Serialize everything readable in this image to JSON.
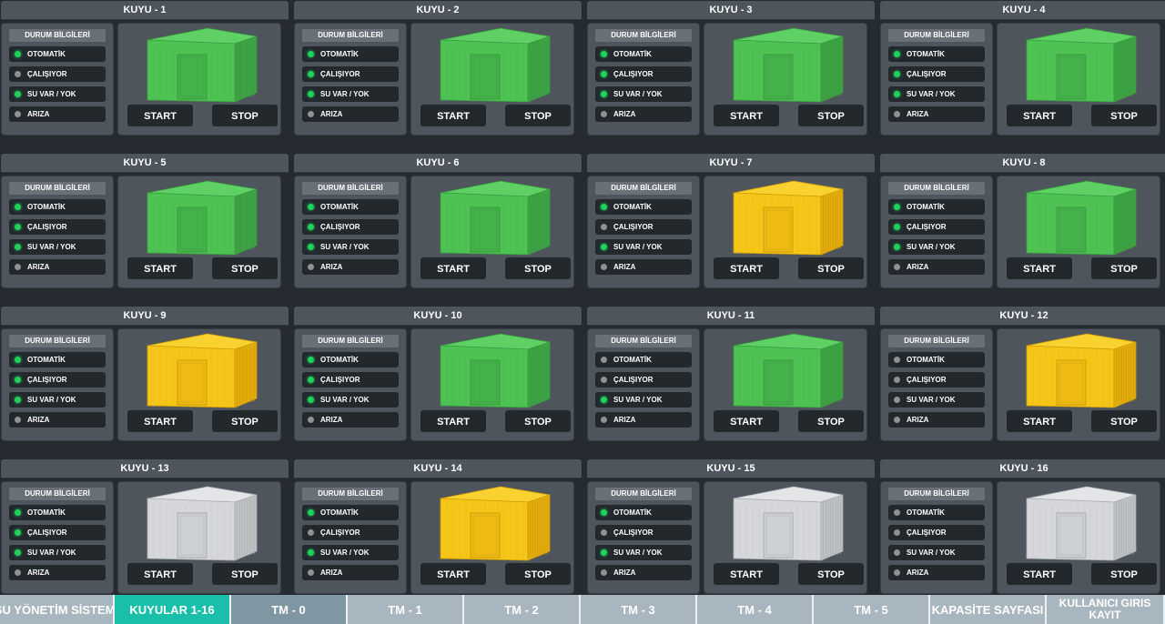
{
  "status_header": "DURUM BİLGİLERİ",
  "status_labels": [
    "OTOMATİK",
    "ÇALIŞIYOR",
    "SU VAR / YOK",
    "ARIZA"
  ],
  "buttons": {
    "start": "START",
    "stop": "STOP"
  },
  "colors": {
    "green": "#4ec353",
    "yellow": "#f5c518",
    "gray": "#d5d7d9",
    "led_on": "#1fd15a",
    "led_off": "#8d9296",
    "tab_active": "#19bfa8"
  },
  "wells": [
    {
      "title": "KUYU - 1",
      "color": "green",
      "leds": [
        true,
        false,
        true,
        false
      ]
    },
    {
      "title": "KUYU - 2",
      "color": "green",
      "leds": [
        true,
        true,
        true,
        false
      ]
    },
    {
      "title": "KUYU - 3",
      "color": "green",
      "leds": [
        true,
        true,
        true,
        false
      ]
    },
    {
      "title": "KUYU - 4",
      "color": "green",
      "leds": [
        true,
        true,
        true,
        false
      ]
    },
    {
      "title": "KUYU - 5",
      "color": "green",
      "leds": [
        true,
        true,
        true,
        false
      ]
    },
    {
      "title": "KUYU - 6",
      "color": "green",
      "leds": [
        true,
        true,
        true,
        false
      ]
    },
    {
      "title": "KUYU - 7",
      "color": "yellow",
      "leds": [
        true,
        false,
        true,
        false
      ]
    },
    {
      "title": "KUYU - 8",
      "color": "green",
      "leds": [
        true,
        true,
        true,
        false
      ]
    },
    {
      "title": "KUYU - 9",
      "color": "yellow",
      "leds": [
        true,
        true,
        true,
        false
      ]
    },
    {
      "title": "KUYU - 10",
      "color": "green",
      "leds": [
        true,
        true,
        true,
        false
      ]
    },
    {
      "title": "KUYU - 11",
      "color": "green",
      "leds": [
        false,
        false,
        true,
        false
      ]
    },
    {
      "title": "KUYU - 12",
      "color": "yellow",
      "leds": [
        false,
        false,
        false,
        false
      ]
    },
    {
      "title": "KUYU - 13",
      "color": "gray",
      "leds": [
        true,
        true,
        true,
        false
      ]
    },
    {
      "title": "KUYU - 14",
      "color": "yellow",
      "leds": [
        true,
        false,
        true,
        false
      ]
    },
    {
      "title": "KUYU - 15",
      "color": "gray",
      "leds": [
        true,
        false,
        true,
        false
      ]
    },
    {
      "title": "KUYU - 16",
      "color": "gray",
      "leds": [
        false,
        false,
        false,
        false
      ]
    }
  ],
  "nav": [
    {
      "label": "SU YÖNETİM SİSTEMİ",
      "state": "normal"
    },
    {
      "label": "KUYULAR 1-16",
      "state": "active"
    },
    {
      "label": "TM - 0",
      "state": "hover"
    },
    {
      "label": "TM - 1",
      "state": "normal"
    },
    {
      "label": "TM - 2",
      "state": "normal"
    },
    {
      "label": "TM - 3",
      "state": "normal"
    },
    {
      "label": "TM - 4",
      "state": "normal"
    },
    {
      "label": "TM - 5",
      "state": "normal"
    },
    {
      "label": "KAPASİTE SAYFASI",
      "state": "normal"
    },
    {
      "label": "KULLANICI GIRIS KAYIT",
      "state": "normal"
    }
  ]
}
